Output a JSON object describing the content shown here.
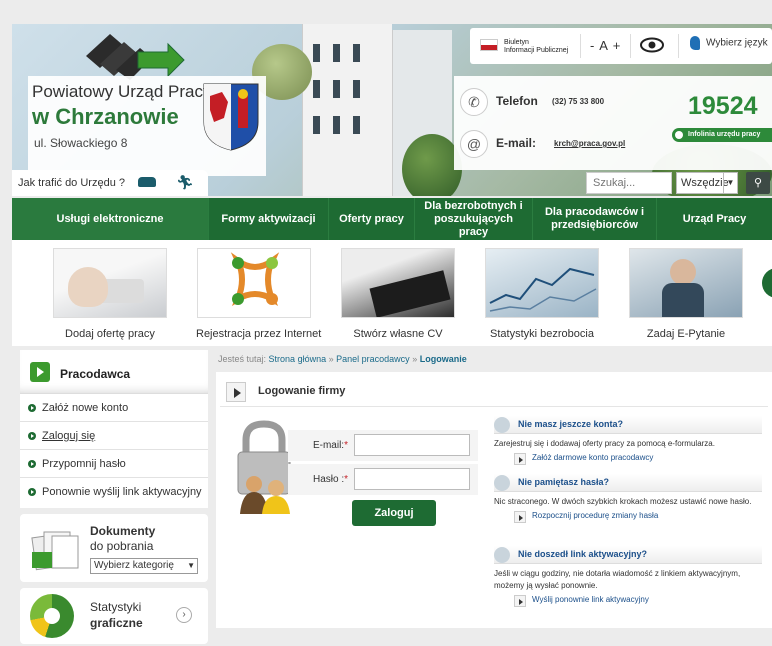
{
  "header": {
    "office_line1": "Powiatowy Urząd Pracy",
    "office_line2": "w Chrzanowie",
    "address": "ul. Słowackiego 8",
    "bip_line1": "Biuletyn",
    "bip_line2": "Informacji Publicznej",
    "font_size_control": "- A +",
    "language_label": "Wybierz język",
    "phone_label": "Telefon",
    "phone_value": "(32) 75 33 800",
    "email_label": "E-mail:",
    "email_value": "krch@praca.gov.pl",
    "helpline_number": "19524",
    "helpline_tag": "Infolinia urzędu pracy",
    "directions_label": "Jak trafić do Urzędu ?",
    "search_placeholder": "Szukaj...",
    "search_scope": "Wszędzie",
    "accent_color": "#1e6b33"
  },
  "nav": {
    "items": [
      {
        "label": "Usługi elektroniczne"
      },
      {
        "label": "Formy aktywizacji"
      },
      {
        "label": "Oferty pracy"
      },
      {
        "label": "Dla bezrobotnych i poszukujących pracy"
      },
      {
        "label": "Dla pracodawców i przedsiębiorców"
      },
      {
        "label": "Urząd Pracy"
      }
    ]
  },
  "tiles": [
    {
      "label": "Dodaj ofertę pracy"
    },
    {
      "label": "Rejestracja przez Internet"
    },
    {
      "label": "Stwórz własne CV"
    },
    {
      "label": "Statystyki bezrobocia"
    },
    {
      "label": "Zadaj E-Pytanie"
    }
  ],
  "sidebar": {
    "title": "Pracodawca",
    "items": [
      {
        "label": "Załóż nowe konto"
      },
      {
        "label": "Zaloguj się"
      },
      {
        "label": "Przypomnij hasło"
      },
      {
        "label": "Ponownie wyślij link aktywacyjny"
      }
    ],
    "docs_title": "Dokumenty",
    "docs_sub": "do pobrania",
    "docs_select": "Wybierz kategorię",
    "stats_title": "Statystyki",
    "stats_sub": "graficzne"
  },
  "breadcrumb": {
    "prefix": "Jesteś tutaj:",
    "home": "Strona główna",
    "sep": "»",
    "panel": "Panel pracodawcy",
    "current": "Logowanie"
  },
  "content": {
    "title": "Logowanie firmy",
    "email_label": "E-mail:",
    "password_label": "Hasło :",
    "required_mark": "*",
    "login_button": "Zaloguj",
    "help": [
      {
        "title": "Nie masz jeszcze konta?",
        "text": "Zarejestruj się i dodawaj oferty pracy za pomocą e-formularza.",
        "link": "Załóż darmowe konto pracodawcy"
      },
      {
        "title": "Nie pamiętasz hasła?",
        "text": "Nic straconego. W dwóch szybkich krokach możesz ustawić nowe hasło.",
        "link": "Rozpocznij procedurę zmiany hasła"
      },
      {
        "title": "Nie doszedł link aktywacyjny?",
        "text": "Jeśli w ciągu godziny, nie dotarła wiadomość z linkiem aktywacyjnym, możemy ją wysłać ponownie.",
        "link": "Wyślij ponownie link aktywacyjny"
      }
    ]
  }
}
